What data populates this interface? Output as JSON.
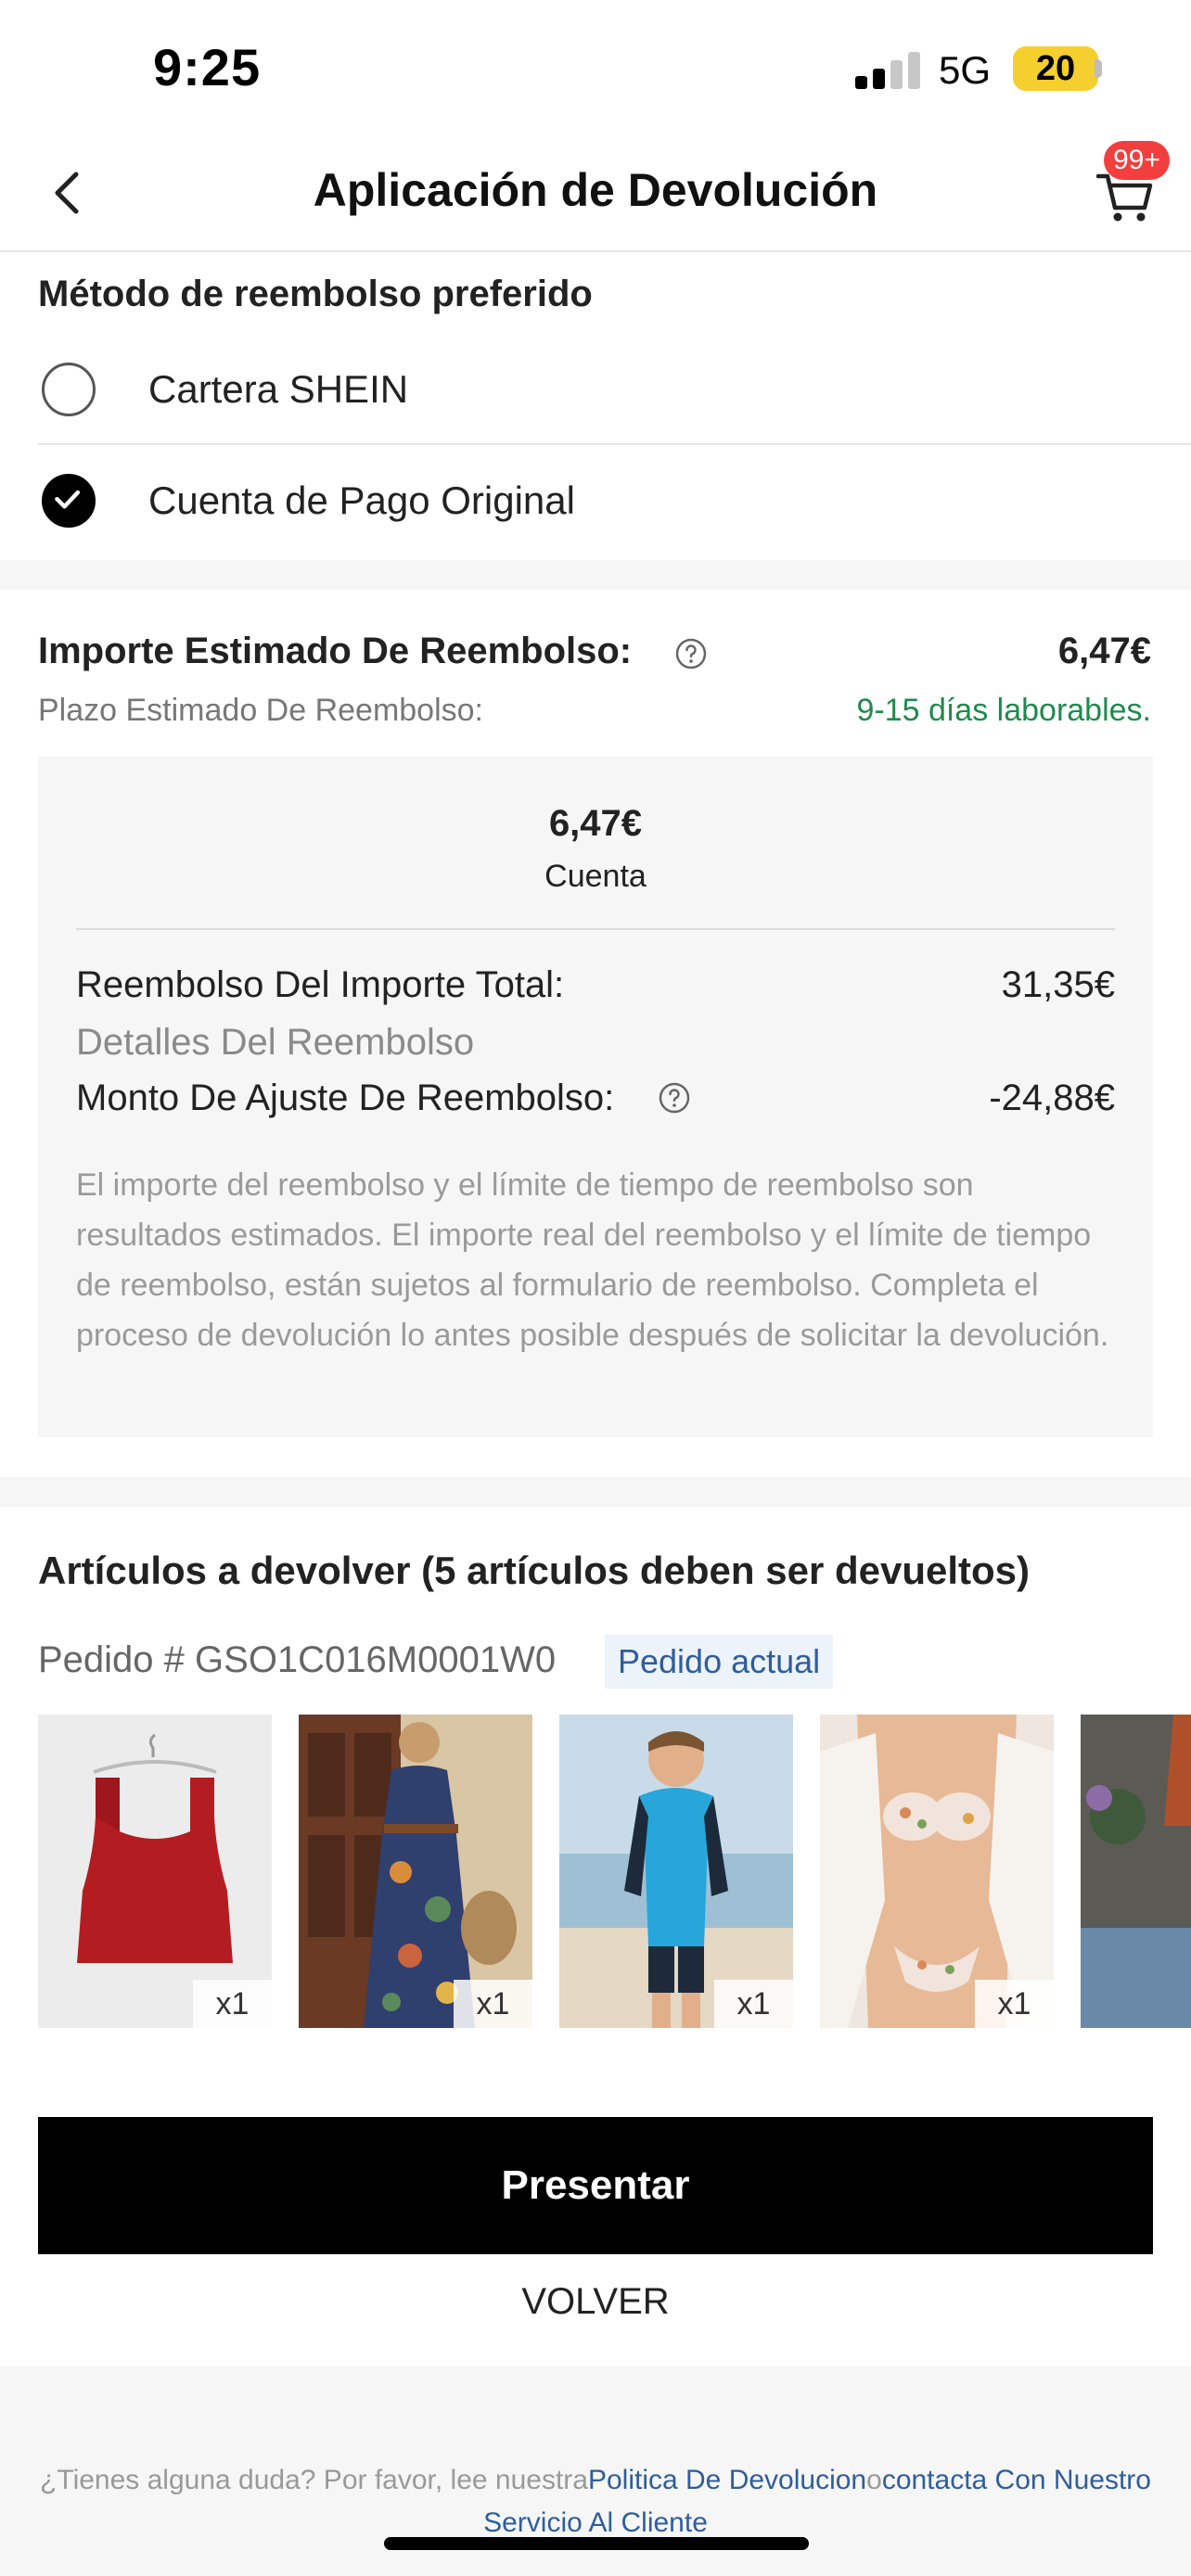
{
  "status_bar": {
    "time": "9:25",
    "network": "5G",
    "battery": "20"
  },
  "header": {
    "title": "Aplicación de Devolución",
    "cart_badge": "99+",
    "back_icon": "chevron-left-icon",
    "cart_icon": "cart-icon"
  },
  "refund_method": {
    "title": "Método de reembolso preferido",
    "options": [
      {
        "label": "Cartera SHEIN",
        "selected": false
      },
      {
        "label": "Cuenta de Pago Original",
        "selected": true
      }
    ]
  },
  "estimate": {
    "label": "Importe Estimado De Reembolso:",
    "amount": "6,47€",
    "term_label": "Plazo Estimado De Reembolso:",
    "term_value": "9-15 días laborables.",
    "box": {
      "amount": "6,47€",
      "account": "Cuenta",
      "total_label": "Reembolso Del Importe Total:",
      "total_value": "31,35€",
      "details_label": "Detalles Del Reembolso",
      "adjust_label": "Monto De Ajuste De Reembolso:",
      "adjust_value": "-24,88€",
      "note": "El importe del reembolso y el límite de tiempo de reembolso son resultados estimados. El importe real del reembolso y el límite de tiempo de reembolso, están sujetos al formulario de reembolso. Completa el proceso de devolución lo antes posible después de solicitar la devolución."
    }
  },
  "items": {
    "title": "Artículos a devolver (5 artículos deben ser devueltos)",
    "order_number": "Pedido # GSO1C016M0001W0",
    "order_tag": "Pedido actual",
    "thumbnails": [
      {
        "name": "red-crop-top",
        "qty": "x1"
      },
      {
        "name": "floral-maxi-dress",
        "qty": "x1"
      },
      {
        "name": "boys-swimsuit",
        "qty": "x1"
      },
      {
        "name": "floral-bikini",
        "qty": "x1"
      },
      {
        "name": "orange-top",
        "qty": ""
      }
    ]
  },
  "actions": {
    "submit": "Presentar",
    "back": "VOLVER"
  },
  "footer": {
    "prefix": "¿Tienes alguna duda? Por favor, lee nuestra",
    "policy_link": "Politica De Devolucion",
    "connector": "o",
    "contact_link": "contacta Con Nuestro Servicio Al Cliente"
  },
  "colors": {
    "accent_green": "#1f8a4c",
    "link_blue": "#2f5d9c",
    "badge_red": "#f33e3e"
  }
}
